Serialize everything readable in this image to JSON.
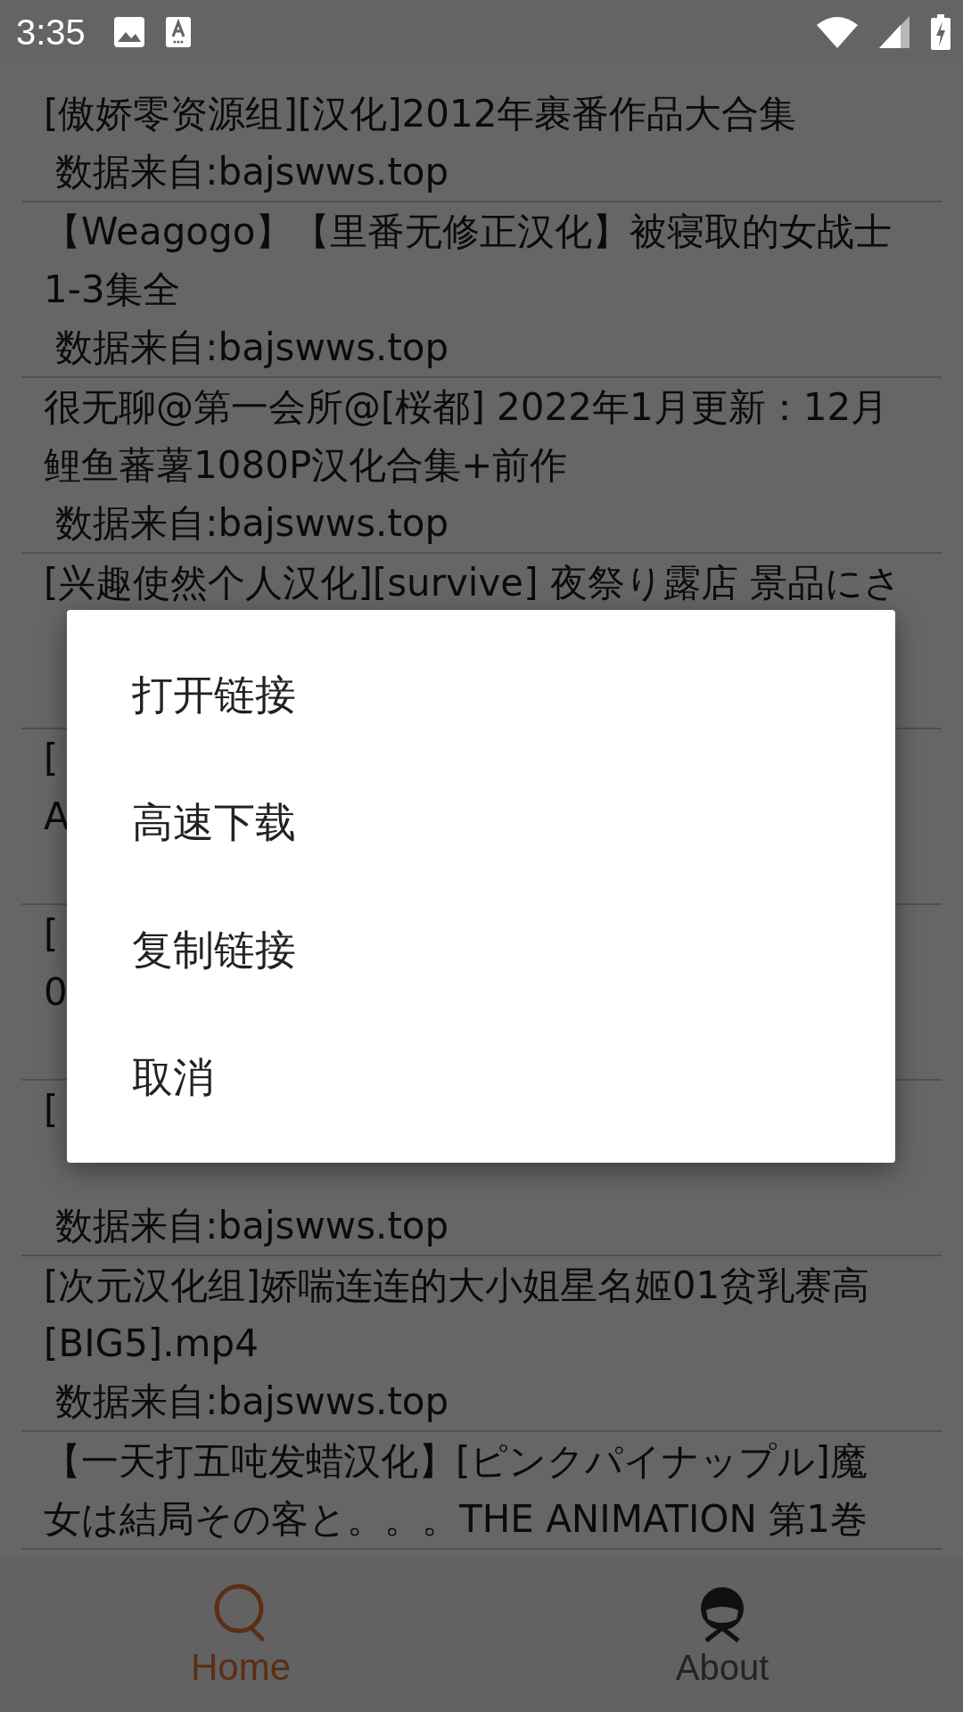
{
  "status_bar": {
    "time": "3:35"
  },
  "list": {
    "items": [
      {
        "title_lines": [
          "[傲娇零资源组][汉化]2012年裹番作品大合集"
        ],
        "source": " 数据来自:bajswws.top"
      },
      {
        "title_lines": [
          "【Weagogo】【里番无修正汉化】被寝取的女战士",
          "1-3集全"
        ],
        "source": " 数据来自:bajswws.top"
      },
      {
        "title_lines": [
          "很无聊@第一会所@[桜都] 2022年1月更新：12月",
          "鲤鱼蕃薯1080P汉化合集+前作"
        ],
        "source": " 数据来自:bajswws.top"
      },
      {
        "title_lines": [
          "[兴趣使然个人汉化][survive] 夜祭り露店 景品にさ"
        ],
        "covered": true
      },
      {
        "title_lines": [
          "[",
          "A"
        ],
        "covered": true
      },
      {
        "title_lines": [
          "[",
          "0"
        ],
        "covered": true
      },
      {
        "title_lines": [
          "["
        ],
        "source": " 数据来自:bajswws.top",
        "covered": true
      },
      {
        "title_lines": [
          "[次元汉化组]娇喘连连的大小姐星名姬01贫乳赛高",
          "[BIG5].mp4"
        ],
        "source": " 数据来自:bajswws.top"
      },
      {
        "title_lines": [
          "【一天打五吨发蜡汉化】[ピンクパイナップル]魔",
          "女は結局その客と。。。THE ANIMATION 第1巻"
        ]
      }
    ]
  },
  "dialog": {
    "options": [
      {
        "label": "打开链接"
      },
      {
        "label": "高速下载"
      },
      {
        "label": "复制链接"
      },
      {
        "label": "取消"
      }
    ]
  },
  "bottom_nav": [
    {
      "label": "Home",
      "kind": "search",
      "selected": true
    },
    {
      "label": "About",
      "kind": "profile",
      "selected": false
    }
  ]
}
